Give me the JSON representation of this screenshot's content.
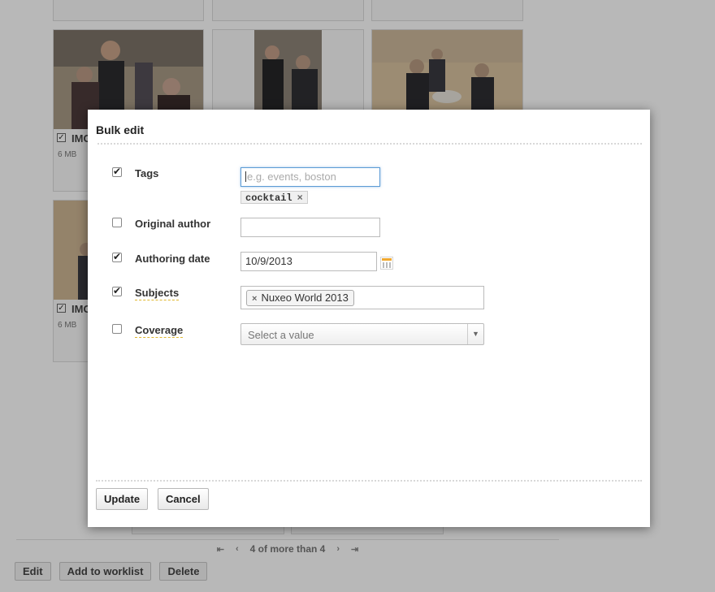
{
  "background": {
    "tiles": [
      {
        "name": "IMG",
        "size": "6 MB"
      },
      {
        "name": "IMG",
        "size": "6 MB"
      }
    ],
    "pager": {
      "first_icon": "first-page-icon",
      "prev_icon": "prev-page-icon",
      "label": "4 of more than 4",
      "next_icon": "next-page-icon",
      "last_icon": "last-page-icon"
    },
    "actions": {
      "edit": "Edit",
      "add_to_worklist": "Add to worklist",
      "delete": "Delete"
    }
  },
  "dialog": {
    "title": "Bulk edit",
    "fields": {
      "tags": {
        "label": "Tags",
        "checked": true,
        "placeholder": "e.g. events, boston",
        "chip": "cocktail",
        "chip_remove": "×"
      },
      "original_author": {
        "label": "Original author",
        "checked": false,
        "value": ""
      },
      "authoring_date": {
        "label": "Authoring date",
        "checked": true,
        "value": "10/9/2013",
        "icon": "calendar-icon"
      },
      "subjects": {
        "label": "Subjects",
        "checked": true,
        "chip": "Nuxeo World 2013",
        "chip_remove": "×"
      },
      "coverage": {
        "label": "Coverage",
        "checked": false,
        "select_value": "Select a value"
      }
    },
    "buttons": {
      "update": "Update",
      "cancel": "Cancel"
    }
  },
  "colors": {
    "overlay": "rgba(0,0,0,0.28)",
    "focus_border": "#5b9bd5",
    "help_underline": "#e0b830",
    "calendar_accent": "#f0a830"
  }
}
